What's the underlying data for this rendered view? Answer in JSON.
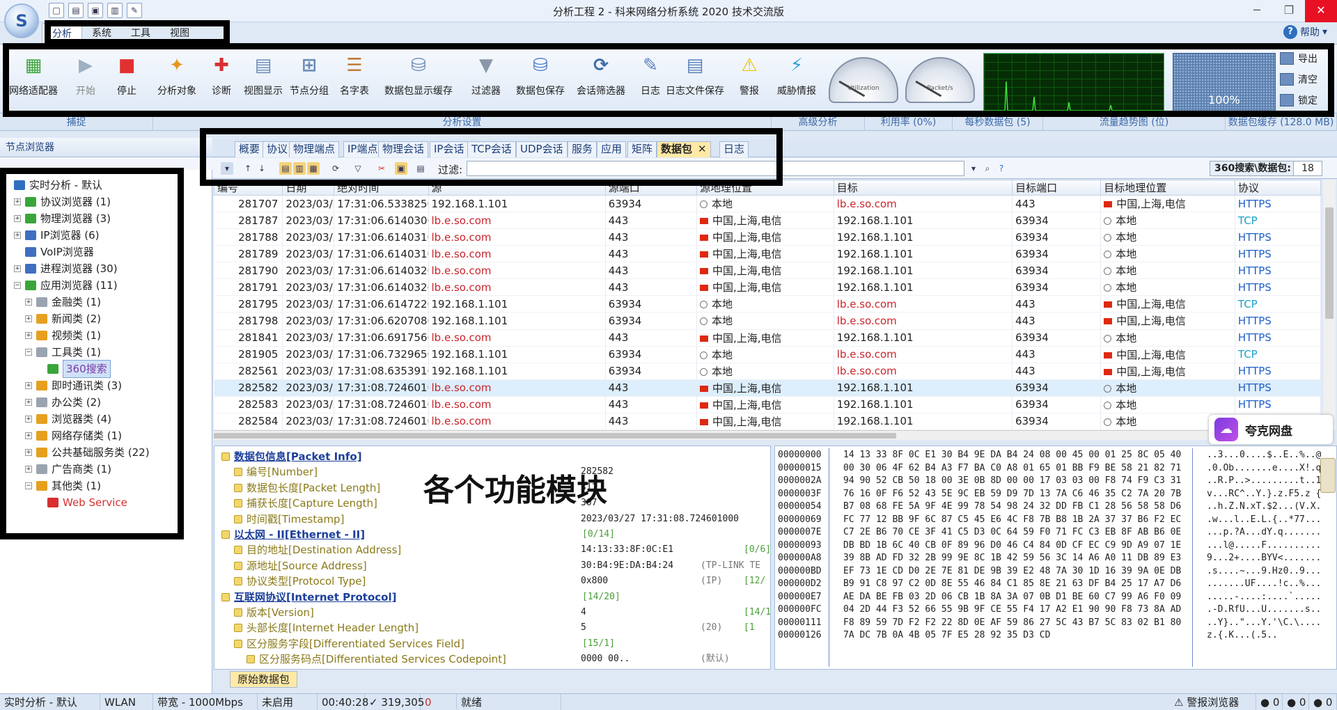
{
  "window": {
    "title": "分析工程 2 - 科来网络分析系统 2020 技术交流版",
    "help_label": "帮助",
    "help_arrow": "▾",
    "logo_glyph": "S",
    "minimize_glyph": "─",
    "restore_glyph": "❐",
    "close_glyph": "✕"
  },
  "quick_access": [
    "□",
    "▤",
    "▣",
    "▥",
    "✎"
  ],
  "ribbon_tabs": [
    "分析",
    "系统",
    "工具",
    "视图"
  ],
  "ribbon": {
    "buttons": [
      {
        "label": "网络适配器",
        "icon": "network-adapter-icon",
        "glyph": "▦",
        "color": "#3aa53a"
      },
      {
        "label": "开始",
        "icon": "play-icon",
        "glyph": "▶",
        "color": "#9fb0c4",
        "disabled": true
      },
      {
        "label": "停止",
        "icon": "stop-icon",
        "glyph": "■",
        "color": "#e03030"
      },
      {
        "label": "分析对象",
        "icon": "analysis-object-icon",
        "glyph": "✦",
        "color": "#e6961f"
      },
      {
        "label": "诊断",
        "icon": "diagnosis-icon",
        "glyph": "✚",
        "color": "#d83030"
      },
      {
        "label": "视图显示",
        "icon": "view-display-icon",
        "glyph": "▤",
        "color": "#6b8ab5"
      },
      {
        "label": "节点分组",
        "icon": "node-group-icon",
        "glyph": "⊞",
        "color": "#6b8ab5"
      },
      {
        "label": "名字表",
        "icon": "name-table-icon",
        "glyph": "☰",
        "color": "#c07a3a"
      },
      {
        "label": "数据包显示缓存",
        "icon": "packet-cache-icon",
        "glyph": "⛁",
        "color": "#6b8ab5"
      },
      {
        "label": "过滤器",
        "icon": "filter-icon",
        "glyph": "▼",
        "color": "#8a97a8"
      },
      {
        "label": "数据包保存",
        "icon": "packet-save-icon",
        "glyph": "⛁",
        "color": "#4a7ac8"
      },
      {
        "label": "会话筛选器",
        "icon": "session-filter-icon",
        "glyph": "⟳",
        "color": "#3f6fa8"
      },
      {
        "label": "日志",
        "icon": "log-icon",
        "glyph": "✎",
        "color": "#5a80b8"
      },
      {
        "label": "日志文件保存",
        "icon": "log-save-icon",
        "glyph": "▤",
        "color": "#5a80b8"
      },
      {
        "label": "警报",
        "icon": "alarm-icon",
        "glyph": "⚠",
        "color": "#f0c000"
      },
      {
        "label": "威胁情报",
        "icon": "threat-intel-icon",
        "glyph": "⚡",
        "color": "#2f9ee0"
      }
    ],
    "gauges": [
      {
        "name": "utilization-gauge",
        "label": "Utilization"
      },
      {
        "name": "packets-gauge",
        "label": "Packet/s"
      }
    ],
    "cache_percent": "100%",
    "cache_level": 1.0,
    "side_buttons": [
      "导出",
      "清空",
      "锁定"
    ]
  },
  "group_labels": [
    {
      "text": "捕捉"
    },
    {
      "text": "分析设置"
    },
    {
      "text": "高级分析"
    },
    {
      "text": "利用率 (0%)"
    },
    {
      "text": "每秒数据包 (5)"
    },
    {
      "text": "流量趋势图 (位)"
    },
    {
      "text": "数据包缓存 (128.0 MB)"
    }
  ],
  "left_panel": {
    "title": "节点浏览器",
    "tree": [
      {
        "label": "实时分析 - 默认",
        "level": 0,
        "exp": "",
        "color": "#2f6fc0"
      },
      {
        "label": "协议浏览器 (1)",
        "level": 1,
        "exp": "+",
        "color": "#3aa53a"
      },
      {
        "label": "物理浏览器 (3)",
        "level": 1,
        "exp": "+",
        "color": "#3aa53a"
      },
      {
        "label": "IP浏览器 (6)",
        "level": 1,
        "exp": "+",
        "color": "#3f6fc0"
      },
      {
        "label": "VoIP浏览器",
        "level": 1,
        "exp": "",
        "color": "#3f6fc0"
      },
      {
        "label": "进程浏览器 (30)",
        "level": 1,
        "exp": "+",
        "color": "#3f6fc0"
      },
      {
        "label": "应用浏览器 (11)",
        "level": 1,
        "exp": "−",
        "color": "#3aa53a"
      },
      {
        "label": "金融类 (1)",
        "level": 2,
        "exp": "+",
        "color": "#9aa4b0"
      },
      {
        "label": "新闻类 (2)",
        "level": 2,
        "exp": "+",
        "color": "#e6a020"
      },
      {
        "label": "视频类 (1)",
        "level": 2,
        "exp": "+",
        "color": "#e6a020"
      },
      {
        "label": "工具类 (1)",
        "level": 2,
        "exp": "−",
        "color": "#9aa4b0"
      },
      {
        "label": "360搜索",
        "level": 3,
        "exp": "",
        "color": "#3aa53a",
        "selected": true
      },
      {
        "label": "即时通讯类 (3)",
        "level": 2,
        "exp": "+",
        "color": "#e6a020"
      },
      {
        "label": "办公类 (2)",
        "level": 2,
        "exp": "+",
        "color": "#9aa4b0"
      },
      {
        "label": "浏览器类 (4)",
        "level": 2,
        "exp": "+",
        "color": "#e6a020"
      },
      {
        "label": "网络存储类 (1)",
        "level": 2,
        "exp": "+",
        "color": "#e6a020"
      },
      {
        "label": "公共基础服务类 (22)",
        "level": 2,
        "exp": "+",
        "color": "#e6a020"
      },
      {
        "label": "广告商类 (1)",
        "level": 2,
        "exp": "+",
        "color": "#9aa4b0"
      },
      {
        "label": "其他类 (1)",
        "level": 2,
        "exp": "−",
        "color": "#e6a020"
      },
      {
        "label": "Web Service",
        "level": 3,
        "exp": "",
        "color": "#d83030",
        "red": true
      }
    ]
  },
  "main_tabs": [
    "概要",
    "协议",
    "物理端点",
    "IP端点",
    "物理会话",
    "IP会话",
    "TCP会话",
    "UDP会话",
    "服务",
    "应用",
    "矩阵",
    "数据包",
    "日志"
  ],
  "active_tab": "数据包",
  "tab_close_glyph": "✕",
  "filter": {
    "label": "过滤:",
    "value": "",
    "count_label": "360搜索\\数据包:",
    "count": "18"
  },
  "table": {
    "columns": [
      "编号",
      "日期",
      "绝对时间",
      "源",
      "源端口",
      "源地理位置",
      "目标",
      "目标端口",
      "目标地理位置",
      "协议"
    ],
    "rows": [
      [
        "281707",
        "2023/03/27",
        "17:31:06.533825000",
        "192.168.1.101",
        "63934",
        "本地",
        "lb.e.so.com",
        "443",
        "中国,上海,电信",
        "HTTPS"
      ],
      [
        "281787",
        "2023/03/27",
        "17:31:06.614030000",
        "lb.e.so.com",
        "443",
        "中国,上海,电信",
        "192.168.1.101",
        "63934",
        "本地",
        "TCP"
      ],
      [
        "281788",
        "2023/03/27",
        "17:31:06.614031000",
        "lb.e.so.com",
        "443",
        "中国,上海,电信",
        "192.168.1.101",
        "63934",
        "本地",
        "HTTPS"
      ],
      [
        "281789",
        "2023/03/27",
        "17:31:06.614031000",
        "lb.e.so.com",
        "443",
        "中国,上海,电信",
        "192.168.1.101",
        "63934",
        "本地",
        "HTTPS"
      ],
      [
        "281790",
        "2023/03/27",
        "17:31:06.614032000",
        "lb.e.so.com",
        "443",
        "中国,上海,电信",
        "192.168.1.101",
        "63934",
        "本地",
        "HTTPS"
      ],
      [
        "281791",
        "2023/03/27",
        "17:31:06.614032000",
        "lb.e.so.com",
        "443",
        "中国,上海,电信",
        "192.168.1.101",
        "63934",
        "本地",
        "HTTPS"
      ],
      [
        "281795",
        "2023/03/27",
        "17:31:06.614722000",
        "192.168.1.101",
        "63934",
        "本地",
        "lb.e.so.com",
        "443",
        "中国,上海,电信",
        "TCP"
      ],
      [
        "281798",
        "2023/03/27",
        "17:31:06.620708000",
        "192.168.1.101",
        "63934",
        "本地",
        "lb.e.so.com",
        "443",
        "中国,上海,电信",
        "HTTPS"
      ],
      [
        "281841",
        "2023/03/27",
        "17:31:06.691756000",
        "lb.e.so.com",
        "443",
        "中国,上海,电信",
        "192.168.1.101",
        "63934",
        "本地",
        "HTTPS"
      ],
      [
        "281905",
        "2023/03/27",
        "17:31:06.732965000",
        "192.168.1.101",
        "63934",
        "本地",
        "lb.e.so.com",
        "443",
        "中国,上海,电信",
        "TCP"
      ],
      [
        "282561",
        "2023/03/27",
        "17:31:08.635391000",
        "192.168.1.101",
        "63934",
        "本地",
        "lb.e.so.com",
        "443",
        "中国,上海,电信",
        "HTTPS"
      ],
      [
        "282582",
        "2023/03/27",
        "17:31:08.724601000",
        "lb.e.so.com",
        "443",
        "中国,上海,电信",
        "192.168.1.101",
        "63934",
        "本地",
        "HTTPS"
      ],
      [
        "282583",
        "2023/03/27",
        "17:31:08.724601000",
        "lb.e.so.com",
        "443",
        "中国,上海,电信",
        "192.168.1.101",
        "63934",
        "本地",
        "HTTPS"
      ],
      [
        "282584",
        "2023/03/27",
        "17:31:08.724601000",
        "lb.e.so.com",
        "443",
        "中国,上海,电信",
        "192.168.1.101",
        "63934",
        "本地",
        "HTTPS"
      ]
    ],
    "selected_row": 11
  },
  "quark": {
    "label": "夸克网盘",
    "glyph": "☁"
  },
  "overlay_text": "各个功能模块",
  "details": [
    {
      "name": "数据包信息[Packet Info]",
      "indent": 0,
      "kind": "head"
    },
    {
      "name": "编号[Number]",
      "indent": 1,
      "kind": "sub",
      "value": "282582"
    },
    {
      "name": "数据包长度[Packet Length]",
      "indent": 1,
      "kind": "sub",
      "value": "311"
    },
    {
      "name": "捕获长度[Capture Length]",
      "indent": 1,
      "kind": "sub",
      "value": "307"
    },
    {
      "name": "时间戳[Timestamp]",
      "indent": 1,
      "kind": "sub",
      "value": "2023/03/27 17:31:08.724601000"
    },
    {
      "name": "以太网 - II[Ethernet - II]",
      "indent": 0,
      "kind": "head",
      "range1": "[0/14]"
    },
    {
      "name": "目的地址[Destination Address]",
      "indent": 1,
      "kind": "sub",
      "value": "14:13:33:8F:0C:E1",
      "range2": "[0/6]"
    },
    {
      "name": "源地址[Source Address]",
      "indent": 1,
      "kind": "sub",
      "value": "30:B4:9E:DA:B4:24",
      "extra": "(TP-LINK TE"
    },
    {
      "name": "协议类型[Protocol Type]",
      "indent": 1,
      "kind": "sub",
      "value": "0x800",
      "extra": "(IP)",
      "range2": "[12/"
    },
    {
      "name": "互联网协议[Internet Protocol]",
      "indent": 0,
      "kind": "head",
      "range1": "[14/20]"
    },
    {
      "name": "版本[Version]",
      "indent": 1,
      "kind": "sub",
      "value": "4",
      "range2": "[14/1]"
    },
    {
      "name": "头部长度[Internet Header Length]",
      "indent": 1,
      "kind": "sub",
      "value": "5",
      "extra": "(20)",
      "range2": "[1"
    },
    {
      "name": "区分服务字段[Differentiated Services Field]",
      "indent": 1,
      "kind": "sub",
      "range1": "[15/1]"
    },
    {
      "name": "区分服务码点[Differentiated Services Codepoint]",
      "indent": 2,
      "kind": "sub",
      "value": "0000 00..",
      "extra": "(默认)"
    },
    {
      "name": "显示拥塞通告[Explicit Congestion Notification]",
      "indent": 2,
      "kind": "sub",
      "value": "......00",
      "extra": "(不带ECN)"
    }
  ],
  "hex": [
    {
      "off": "00000000",
      "bytes": "14 13 33 8F 0C E1 30 B4 9E DA B4 24 08 00 45 00 01 25 8C 05 40",
      "ascii": "..3...0....$..E..%..@"
    },
    {
      "off": "00000015",
      "bytes": "00 30 06 4F 62 B4 A3 F7 BA C0 A8 01 65 01 BB F9 BE 58 21 82 71",
      "ascii": ".0.Ob.......e....X!.q"
    },
    {
      "off": "0000002A",
      "bytes": "94 90 52 CB 50 18 00 3E 0B 8D 00 00 17 03 03 00 F8 74 F9 C3 31",
      "ascii": "..R.P..>.........t..1"
    },
    {
      "off": "0000003F",
      "bytes": "76 16 0F F6 52 43 5E 9C EB 59 D9 7D 13 7A C6 46 35 C2 7A 20 7B",
      "ascii": "v...RC^..Y.}.z.F5.z {"
    },
    {
      "off": "00000054",
      "bytes": "B7 08 68 FE 5A 9F 4E 99 78 54 98 24 32 DD FB C1 28 56 58 58 D6",
      "ascii": "..h.Z.N.xT.$2...(V.X."
    },
    {
      "off": "00000069",
      "bytes": "FC 77 12 BB 9F 6C 87 C5 45 E6 4C F8 7B B8 1B 2A 37 37 B6 F2 EC",
      "ascii": ".w...l..E.L.{..*77..."
    },
    {
      "off": "0000007E",
      "bytes": "C7 2E B6 70 CE 3F 41 C5 D3 0C 64 59 F0 71 FC C3 EB 8F AB B6 0E",
      "ascii": "...p.?A...dY.q......."
    },
    {
      "off": "00000093",
      "bytes": "DB BD 1B 6C 40 CB 0F 89 96 D0 46 C4 84 0D CF EC C9 9D A9 07 1E",
      "ascii": "...l@.....F.........."
    },
    {
      "off": "000000A8",
      "bytes": "39 8B AD FD 32 2B 99 9E 8C 1B 42 59 56 3C 14 A6 A0 11 DB 89 E3",
      "ascii": "9...2+....BYV<......."
    },
    {
      "off": "000000BD",
      "bytes": "EF 73 1E CD D0 2E 7E 81 DE 9B 39 E2 48 7A 30 1D 16 39 9A 0E DB",
      "ascii": ".s....~...9.Hz0..9..."
    },
    {
      "off": "000000D2",
      "bytes": "B9 91 C8 97 C2 0D 8E 55 46 84 C1 85 8E 21 63 DF B4 25 17 A7 D6",
      "ascii": ".......UF....!c..%..."
    },
    {
      "off": "000000E7",
      "bytes": "AE DA BE FB 03 2D 06 CB 1B 8A 3A 07 0B D1 BE 60 C7 99 A6 F0 09",
      "ascii": ".....-....:....`....."
    },
    {
      "off": "000000FC",
      "bytes": "04 2D 44 F3 52 66 55 9B 9F CE 55 F4 17 A2 E1 90 90 F8 73 8A AD",
      "ascii": ".-D.RfU...U.......s.."
    },
    {
      "off": "00000111",
      "bytes": "F8 89 59 7D F2 F2 22 8D 0E AF 59 86 27 5C 43 B7 5C 83 02 B1 80",
      "ascii": "..Y}..\"...Y.'\\C.\\...."
    },
    {
      "off": "00000126",
      "bytes": "7A DC 7B 0A 4B 05 7F E5 28 92 35 D3 CD",
      "ascii": "z.{.K...(.5.."
    }
  ],
  "raw_tab": "原始数据包",
  "status": [
    {
      "text": "实时分析 - 默认",
      "icon": "realtime-icon"
    },
    {
      "text": "WLAN",
      "icon": "wlan-icon"
    },
    {
      "text": "带宽 - 1000Mbps",
      "icon": "bandwidth-icon"
    },
    {
      "text": "未启用",
      "icon": "filter-off-icon"
    },
    {
      "text": "00:40:28",
      "icon": ""
    },
    {
      "text": "✓ 319,305",
      "icon": "packets-icon"
    },
    {
      "text": "0",
      "icon": "dropped-icon"
    },
    {
      "text": "就绪",
      "icon": ""
    },
    {
      "text": "⚠ 警报浏览器",
      "icon": "alarm-browser-icon"
    },
    {
      "text": "● 0",
      "icon": "alarm-count-1"
    },
    {
      "text": "● 0",
      "icon": "alarm-count-2"
    },
    {
      "text": "● 0",
      "icon": "alarm-count-3"
    }
  ]
}
